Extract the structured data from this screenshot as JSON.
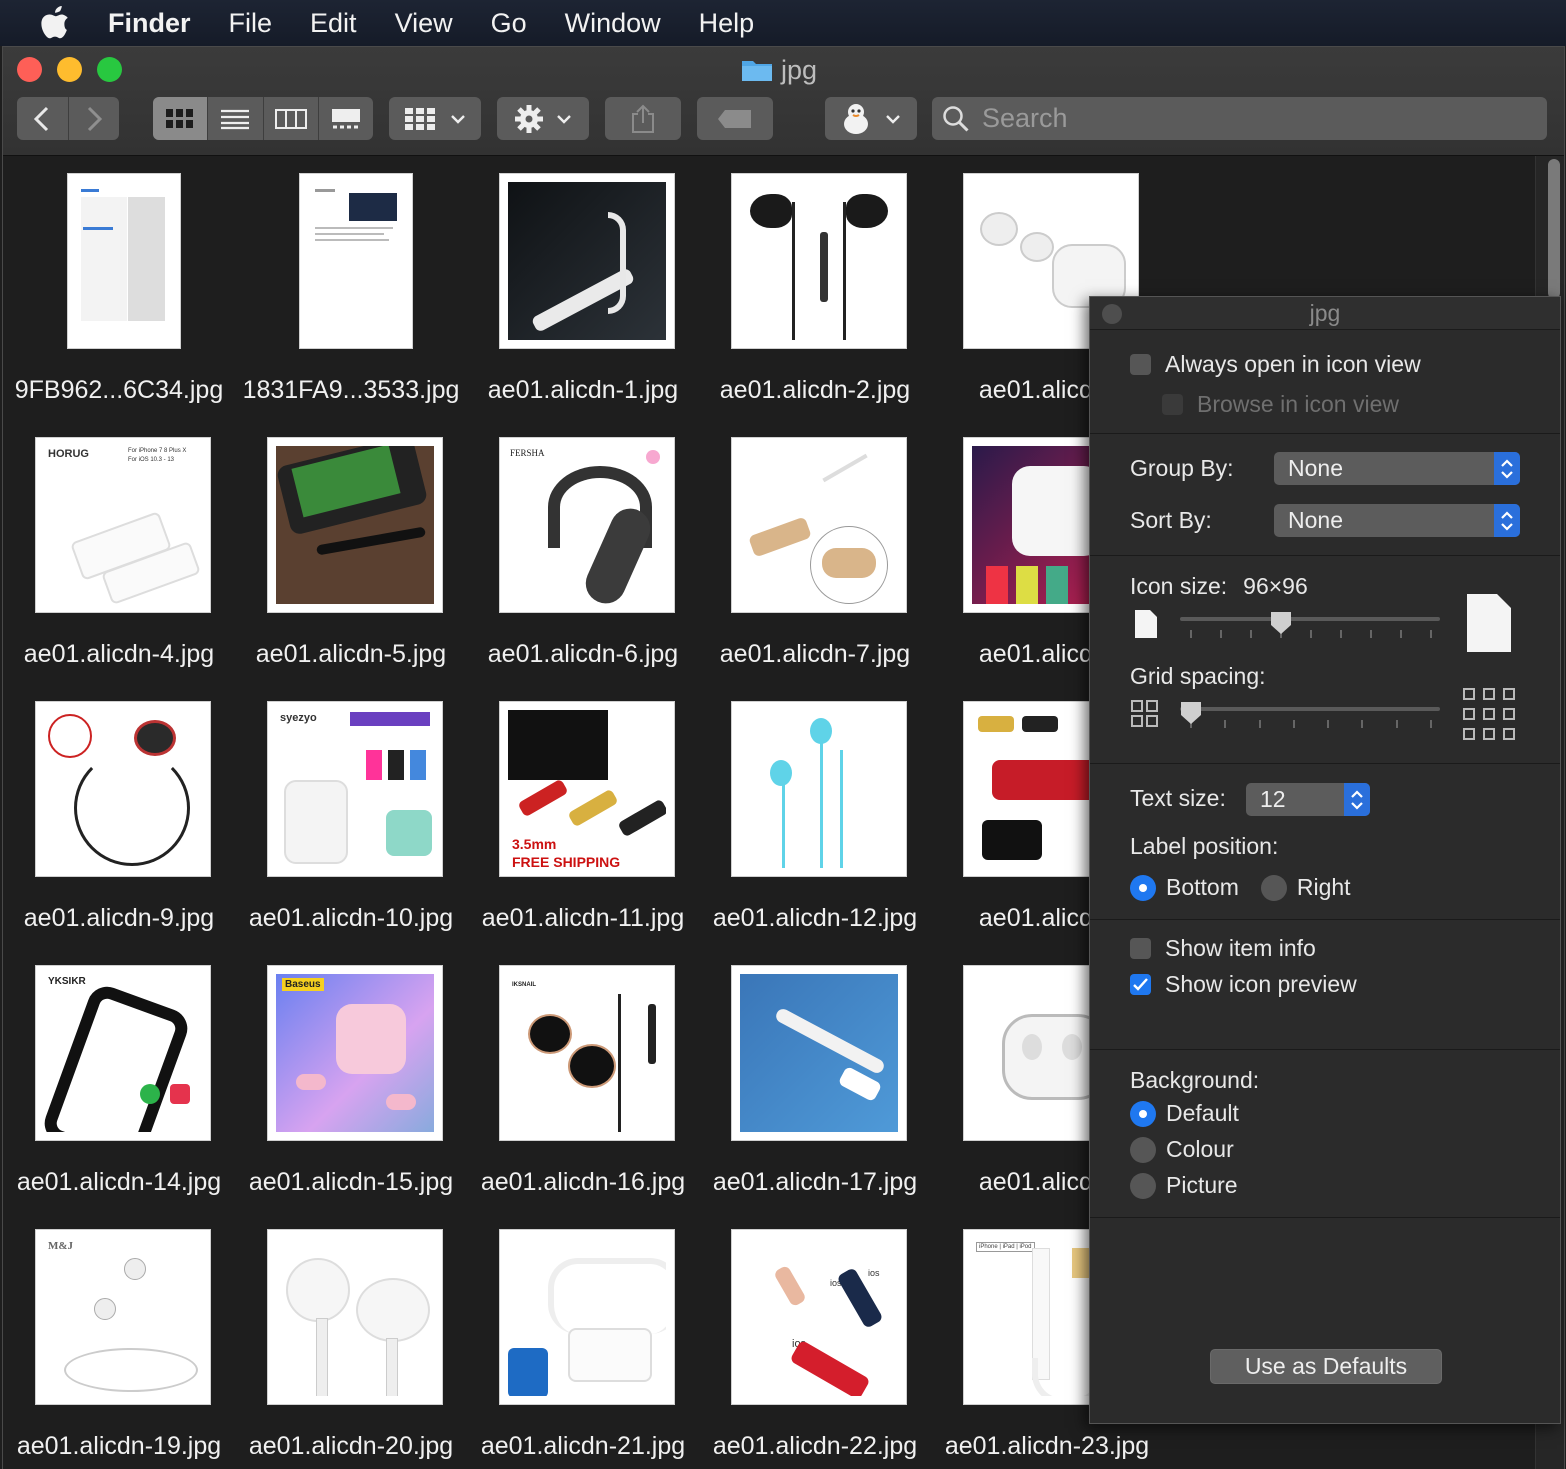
{
  "menubar": {
    "items": [
      "Finder",
      "File",
      "Edit",
      "View",
      "Go",
      "Window",
      "Help"
    ]
  },
  "window": {
    "title": "jpg",
    "search_placeholder": "Search",
    "toolbar": {
      "icons": [
        "back-chevron-icon",
        "forward-chevron-icon",
        "icon-view-icon",
        "list-view-icon",
        "column-view-icon",
        "gallery-view-icon",
        "group-icon",
        "gear-icon",
        "share-icon",
        "tag-icon",
        "user-profile-icon"
      ],
      "selected_view": "icon"
    }
  },
  "files": [
    {
      "name": "9FB962...6C34.jpg",
      "kind": "doc1"
    },
    {
      "name": "1831FA9...3533.jpg",
      "kind": "doc2"
    },
    {
      "name": "ae01.alicdn-1.jpg",
      "kind": "adapter-dark"
    },
    {
      "name": "ae01.alicdn-2.jpg",
      "kind": "earbuds-black"
    },
    {
      "name": "ae01.alicdn-",
      "kind": "earpods"
    },
    {
      "name": "ae01.alicdn-4.jpg",
      "kind": "splitter-white"
    },
    {
      "name": "ae01.alicdn-5.jpg",
      "kind": "phone-cable"
    },
    {
      "name": "ae01.alicdn-6.jpg",
      "kind": "headset"
    },
    {
      "name": "ae01.alicdn-7.jpg",
      "kind": "gold-adapter"
    },
    {
      "name": "ae01.alicdn-",
      "kind": "airpods-color"
    },
    {
      "name": "ae01.alicdn-9.jpg",
      "kind": "neckband"
    },
    {
      "name": "ae01.alicdn-10.jpg",
      "kind": "i7-airpods"
    },
    {
      "name": "ae01.alicdn-11.jpg",
      "kind": "adapters-promo"
    },
    {
      "name": "ae01.alicdn-12.jpg",
      "kind": "cyan-earbuds"
    },
    {
      "name": "ae01.alicdn-",
      "kind": "red-splitter"
    },
    {
      "name": "ae01.alicdn-14.jpg",
      "kind": "yksikr"
    },
    {
      "name": "ae01.alicdn-15.jpg",
      "kind": "baseus"
    },
    {
      "name": "ae01.alicdn-16.jpg",
      "kind": "iksnail"
    },
    {
      "name": "ae01.alicdn-17.jpg",
      "kind": "blue-adapter"
    },
    {
      "name": "ae01.alicdn-",
      "kind": "earpods-case"
    },
    {
      "name": "ae01.alicdn-19.jpg",
      "kind": "mj-earbuds"
    },
    {
      "name": "ae01.alicdn-20.jpg",
      "kind": "white-earbuds"
    },
    {
      "name": "ae01.alicdn-21.jpg",
      "kind": "lightning-splitter"
    },
    {
      "name": "ae01.alicdn-22.jpg",
      "kind": "ios-adapters"
    },
    {
      "name": "ae01.alicdn-23.jpg",
      "kind": "lightning-jack"
    }
  ],
  "thumb_text": {
    "horug": "HORUG",
    "horug_sub": "For iPhone 7 8 Plus X",
    "horug_sub2": "For iOS 10.3 - 13",
    "fersha": "FERSHA",
    "syezyo": "syezyo",
    "promo_size": "3.5mm",
    "promo_ship": "FREE SHIPPING",
    "yksikr": "YKSIKR",
    "baseus": "Baseus",
    "iksnail": "IKSNAIL",
    "mj": "M&J",
    "ios": "ios",
    "iphone_ipad": "iPhone | iPad | iPod"
  },
  "view_options": {
    "title": "jpg",
    "always_open_icon_view": {
      "label": "Always open in icon view",
      "checked": false
    },
    "browse_icon_view": {
      "label": "Browse in icon view",
      "checked": false,
      "enabled": false
    },
    "group_by_label": "Group By:",
    "group_by_value": "None",
    "sort_by_label": "Sort By:",
    "sort_by_value": "None",
    "icon_size_label": "Icon size:",
    "icon_size_value": "96×96",
    "icon_size_fraction": 0.38,
    "grid_spacing_label": "Grid spacing:",
    "grid_spacing_fraction": 0.0,
    "text_size_label": "Text size:",
    "text_size_value": "12",
    "label_position_label": "Label position:",
    "label_positions": [
      {
        "label": "Bottom",
        "selected": true
      },
      {
        "label": "Right",
        "selected": false
      }
    ],
    "show_item_info": {
      "label": "Show item info",
      "checked": false
    },
    "show_icon_preview": {
      "label": "Show icon preview",
      "checked": true
    },
    "background_label": "Background:",
    "backgrounds": [
      {
        "label": "Default",
        "selected": true
      },
      {
        "label": "Colour",
        "selected": false
      },
      {
        "label": "Picture",
        "selected": false
      }
    ],
    "use_as_defaults": "Use as Defaults"
  },
  "colors": {
    "accent": "#1f78f0",
    "menubar": "#1a2030",
    "window_bg": "#1e1e1e",
    "panel_bg": "#2b2b2b"
  }
}
